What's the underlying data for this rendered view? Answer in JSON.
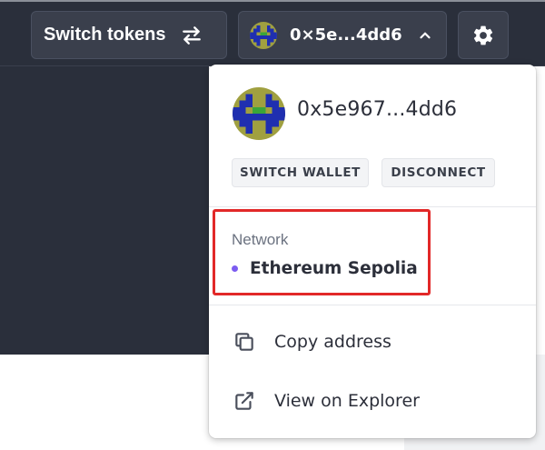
{
  "header": {
    "switch_tokens_label": "Switch tokens",
    "account_short_address": "0×5e...4dd6"
  },
  "dropdown": {
    "full_address": "0x5e967...4dd6",
    "switch_wallet_label": "SWITCH WALLET",
    "disconnect_label": "DISCONNECT",
    "network_label": "Network",
    "network_name": "Ethereum Sepolia",
    "copy_address_label": "Copy address",
    "view_explorer_label": "View on Explorer"
  },
  "icons": {
    "switch": "switch-arrows-icon",
    "chevron": "chevron-up-icon",
    "settings": "gear-icon",
    "copy": "copy-icon",
    "external": "external-link-icon"
  },
  "colors": {
    "header_bg": "#2a2f3b",
    "button_bg": "#3a3f4c",
    "network_dot": "#7c5cf0",
    "highlight": "#e22828",
    "avatar_olive": "#a0a040",
    "avatar_blue": "#1f2fb0",
    "avatar_green": "#3aa63a"
  }
}
